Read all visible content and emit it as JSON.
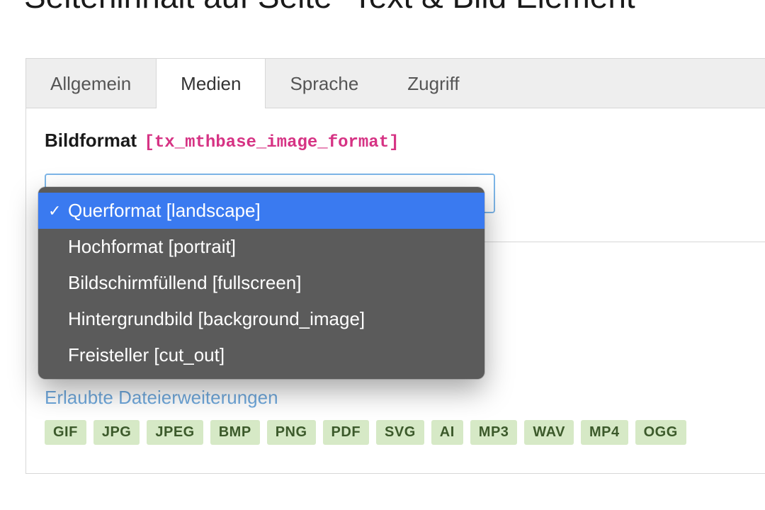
{
  "page_title": "Seiteninhalt auf Seite \"Text & Bild Element",
  "tabs": [
    {
      "label": "Allgemein",
      "active": false
    },
    {
      "label": "Medien",
      "active": true
    },
    {
      "label": "Sprache",
      "active": false
    },
    {
      "label": "Zugriff",
      "active": false
    }
  ],
  "field": {
    "label": "Bildformat",
    "tech": "[tx_mthbase_image_format]"
  },
  "dropdown": {
    "items": [
      {
        "label": "Querformat [landscape]",
        "selected": true
      },
      {
        "label": "Hochformat [portrait]",
        "selected": false
      },
      {
        "label": "Bildschirmfüllend [fullscreen]",
        "selected": false
      },
      {
        "label": "Hintergrundbild [background_image]",
        "selected": false
      },
      {
        "label": "Freisteller [cut_out]",
        "selected": false
      }
    ]
  },
  "allowed": {
    "label": "Erlaubte Dateierweiterungen",
    "badges": [
      "GIF",
      "JPG",
      "JPEG",
      "BMP",
      "PNG",
      "PDF",
      "SVG",
      "AI",
      "MP3",
      "WAV",
      "MP4",
      "OGG"
    ]
  }
}
